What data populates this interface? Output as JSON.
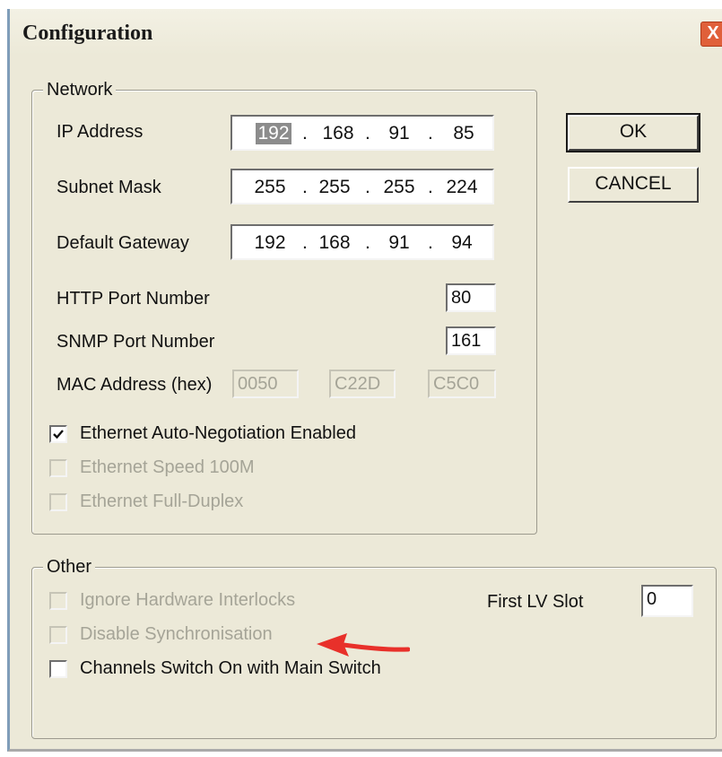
{
  "window": {
    "title": "Configuration",
    "close_glyph": "X"
  },
  "network": {
    "legend": "Network",
    "ip_label": "IP Address",
    "ip": [
      "192",
      "168",
      "91",
      "85"
    ],
    "subnet_label": "Subnet Mask",
    "subnet": [
      "255",
      "255",
      "255",
      "224"
    ],
    "gateway_label": "Default Gateway",
    "gateway": [
      "192",
      "168",
      "91",
      "94"
    ],
    "http_label": "HTTP Port Number",
    "http_port": "80",
    "snmp_label": "SNMP Port Number",
    "snmp_port": "161",
    "mac_label": "MAC Address (hex)",
    "mac": [
      "0050",
      "C22D",
      "C5C0"
    ],
    "checkboxes": [
      {
        "label": "Ethernet Auto-Negotiation Enabled",
        "checked": true,
        "enabled": true
      },
      {
        "label": "Ethernet Speed 100M",
        "checked": false,
        "enabled": false
      },
      {
        "label": "Ethernet Full-Duplex",
        "checked": false,
        "enabled": false
      }
    ]
  },
  "buttons": {
    "ok": "OK",
    "cancel": "CANCEL"
  },
  "other": {
    "legend": "Other",
    "checkboxes": [
      {
        "label": "Ignore Hardware Interlocks",
        "checked": false,
        "enabled": false
      },
      {
        "label": "Disable Synchronisation",
        "checked": false,
        "enabled": false
      },
      {
        "label": "Channels Switch On with Main Switch",
        "checked": false,
        "enabled": true
      }
    ],
    "first_lv_label": "First LV Slot",
    "first_lv_value": "0"
  },
  "colors": {
    "annotation_arrow": "#e8302a"
  },
  "icons": {
    "check": "checkmark-icon",
    "annotation": "red-arrow-icon"
  }
}
